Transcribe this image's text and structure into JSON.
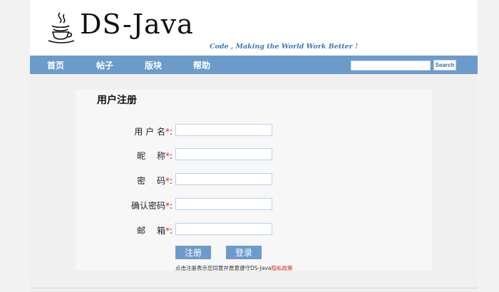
{
  "header": {
    "logo_text": "DS-Java",
    "slogan": "Code , Making the World Work Better !",
    "logo_icon": "java-coffee-cup-icon"
  },
  "nav": {
    "items": [
      {
        "label": "首页"
      },
      {
        "label": "帖子"
      },
      {
        "label": "版块"
      },
      {
        "label": "帮助"
      }
    ],
    "search_value": "",
    "search_button": "Search"
  },
  "form": {
    "title": "用户注册",
    "required_mark": "*",
    "colon": ":",
    "fields": [
      {
        "label": "用 户 名",
        "value": ""
      },
      {
        "label": "昵　 称",
        "value": ""
      },
      {
        "label": "密　 码",
        "value": ""
      },
      {
        "label": "确认密码",
        "value": ""
      },
      {
        "label": "邮　 箱",
        "value": ""
      }
    ],
    "register_button": "注册",
    "login_button": "登录",
    "agreement_text": "点击注册表示您同意并愿意遵守DS-Java",
    "policy_link": "隐私政策"
  },
  "colors": {
    "nav_bg": "#6c9bcb",
    "slogan": "#3e79b5",
    "required": "#e02020",
    "input_border": "#b7d2ec"
  }
}
